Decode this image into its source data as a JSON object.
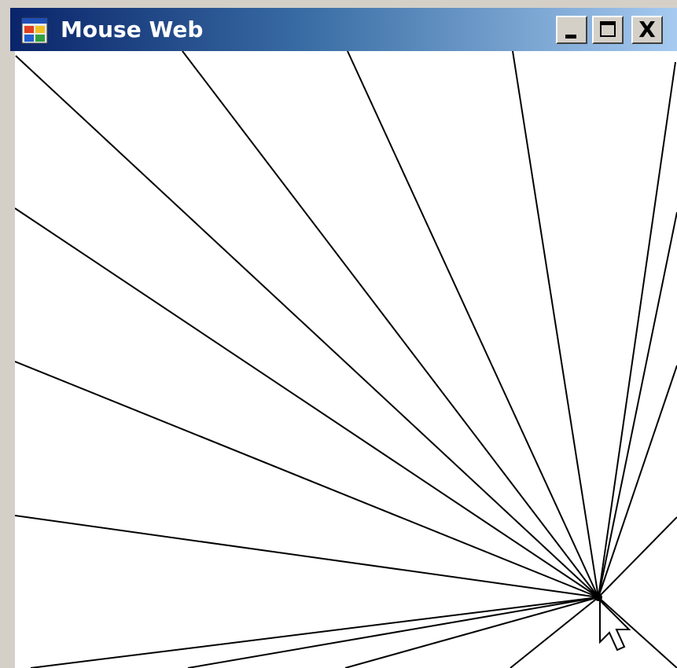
{
  "window": {
    "title": "Mouse Web",
    "icon": "app-window-icon",
    "controls": [
      "minimize-icon",
      "maximize-icon",
      "close-icon"
    ],
    "close_glyph": "X",
    "titlebar_colors": [
      "#0a246a",
      "#a6caf0"
    ]
  },
  "canvas": {
    "background": "#ffffff",
    "line_color": "#000000",
    "cursor_icon": "arrow-cursor-icon"
  }
}
